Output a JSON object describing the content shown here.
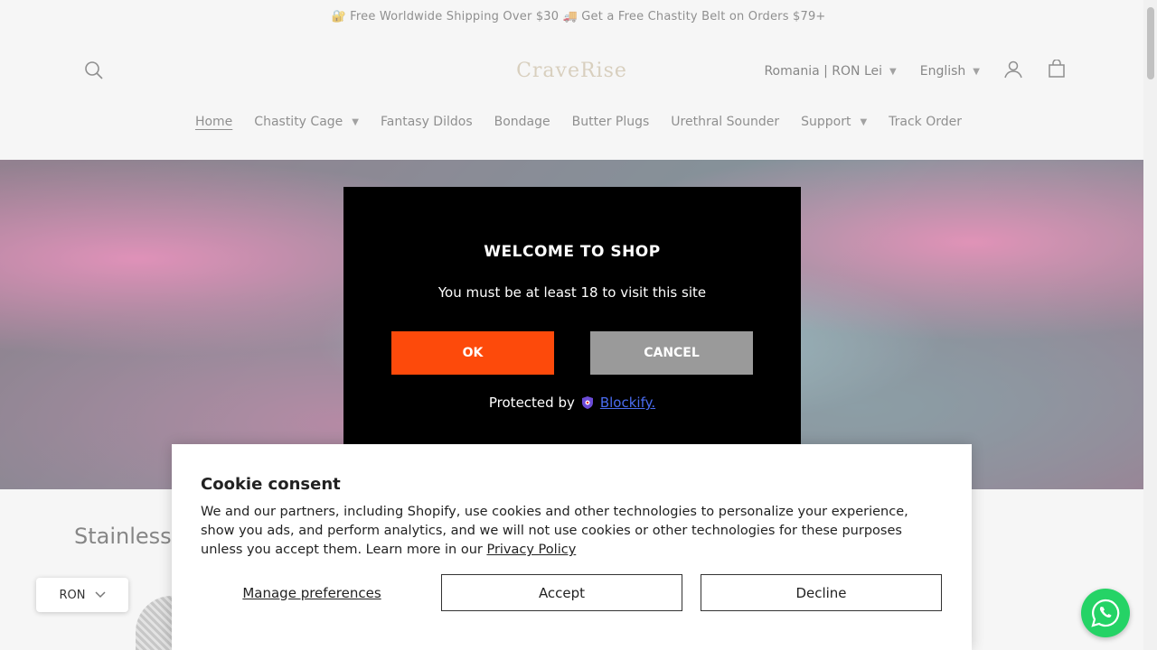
{
  "announcement": "🔐 Free Worldwide Shipping Over $30 🚚 Get a Free Chastity Belt on Orders $79+",
  "header": {
    "logo": "CraveRise",
    "country": "Romania | RON Lei",
    "language": "English"
  },
  "nav": {
    "items": [
      {
        "label": "Home",
        "active": true,
        "dropdown": false
      },
      {
        "label": "Chastity Cage",
        "dropdown": true
      },
      {
        "label": "Fantasy Dildos",
        "dropdown": false
      },
      {
        "label": "Bondage",
        "dropdown": false
      },
      {
        "label": "Butter Plugs",
        "dropdown": false
      },
      {
        "label": "Urethral Sounder",
        "dropdown": false
      },
      {
        "label": "Support",
        "dropdown": true
      },
      {
        "label": "Track Order",
        "dropdown": false
      }
    ]
  },
  "section_title": "Stainless S",
  "age_modal": {
    "title": "WELCOME TO SHOP",
    "message": "You must be at least 18 to visit this site",
    "ok_label": "OK",
    "cancel_label": "CANCEL",
    "protected_by": "Protected by",
    "brand_link": "Blockify.",
    "ok_color": "#fd4a0b",
    "cancel_color": "#9a9a9a"
  },
  "cookie": {
    "title": "Cookie consent",
    "text": "We and our partners, including Shopify, use cookies and other technologies to personalize your experience, show you ads, and perform analytics, and we will not use cookies or other technologies for these purposes unless you accept them. Learn more in our ",
    "privacy_link": "Privacy Policy",
    "manage_label": "Manage preferences",
    "accept_label": "Accept",
    "decline_label": "Decline"
  },
  "currency": {
    "code": "RON"
  },
  "icons": {
    "search": "search-icon",
    "account": "account-icon",
    "cart": "cart-icon",
    "whatsapp": "whatsapp-icon"
  }
}
